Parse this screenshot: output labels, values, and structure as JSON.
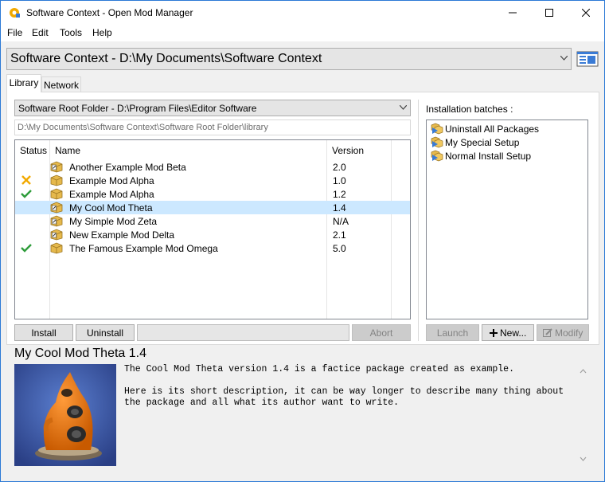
{
  "window": {
    "title": "Software Context - Open Mod Manager",
    "app_icon": "gear-puzzle-icon",
    "controls": [
      "minimize-icon",
      "maximize-icon",
      "close-icon"
    ]
  },
  "menu": {
    "items": [
      "File",
      "Edit",
      "Tools",
      "Help"
    ]
  },
  "context": {
    "selected": "Software Context - D:\\My Documents\\Software Context",
    "properties_icon": "window-properties-icon"
  },
  "tabs": [
    {
      "label": "Library",
      "active": true
    },
    {
      "label": "Network",
      "active": false
    }
  ],
  "library": {
    "root_folder": "Software Root Folder - D:\\Program Files\\Editor Software",
    "library_path": "D:\\My Documents\\Software Context\\Software Root Folder\\library",
    "columns": [
      "Status",
      "Name",
      "Version"
    ],
    "mods": [
      {
        "status": "",
        "name": "Another Example Mod Beta",
        "version": "2.0",
        "icon": "package-edit-icon"
      },
      {
        "status": "error",
        "name": "Example Mod Alpha",
        "version": "1.0",
        "icon": "package-icon"
      },
      {
        "status": "installed",
        "name": "Example Mod Alpha",
        "version": "1.2",
        "icon": "package-icon"
      },
      {
        "status": "",
        "name": "My Cool Mod Theta",
        "version": "1.4",
        "icon": "package-edit-icon",
        "selected": true
      },
      {
        "status": "",
        "name": "My Simple Mod Zeta",
        "version": "N/A",
        "icon": "package-edit-icon"
      },
      {
        "status": "",
        "name": "New Example Mod Delta",
        "version": "2.1",
        "icon": "package-edit-icon"
      },
      {
        "status": "installed",
        "name": "The Famous Example Mod Omega",
        "version": "5.0",
        "icon": "package-icon"
      }
    ],
    "buttons": {
      "install": "Install",
      "uninstall": "Uninstall",
      "abort": "Abort"
    }
  },
  "batches": {
    "label": "Installation batches :",
    "items": [
      "Uninstall All Packages",
      "My Special Setup",
      "Normal Install Setup"
    ],
    "buttons": {
      "launch": "Launch",
      "new": "New...",
      "modify": "Modify"
    }
  },
  "details": {
    "title": "My Cool Mod Theta 1.4",
    "description": "The Cool Mod Theta version 1.4 is a factice package created as example.\n\nHere is its short description, it can be way longer to describe many thing about\nthe package and all what its author want to write."
  },
  "colors": {
    "selection": "#cce8ff",
    "installed": "#2e9c3a",
    "error": "#f2a900",
    "preview_bg": "#3a56a5",
    "mascot": "#f07a10"
  }
}
